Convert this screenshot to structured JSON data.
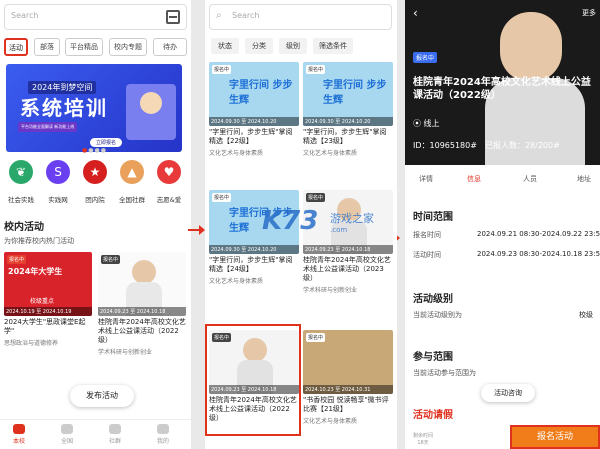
{
  "panel1": {
    "search_placeholder": "Search",
    "tabs": [
      "活动",
      "部落",
      "平台精品",
      "校内专题",
      "待办"
    ],
    "banner": {
      "line1": "2024年到梦空间",
      "line2": "系统培训",
      "line3": "平台功能全面解读 新功能上线",
      "button": "立即报名"
    },
    "icons": [
      {
        "label": "社会实践",
        "icon": "leaf-icon",
        "color": "#2aa76b"
      },
      {
        "label": "实践网",
        "icon": "s-logo-icon",
        "color": "#6a3ff0"
      },
      {
        "label": "团内院",
        "icon": "emblem-icon",
        "color": "#d62020"
      },
      {
        "label": "全国社群",
        "icon": "people-icon",
        "color": "#e8a05a"
      },
      {
        "label": "志愿&爱",
        "icon": "heart-icon",
        "color": "#e83a3a"
      }
    ],
    "section_title": "校内活动",
    "section_subtitle": "为你推荐校内热门活动",
    "cards": [
      {
        "img_text": "2024年大学生",
        "img_sub": "校级重点",
        "date": "2024.10.19 至 2024.10.19",
        "title": "2024大学生\"思政课堂E起学\"",
        "subtitle": "思想政治与道德修养"
      },
      {
        "img_text": "",
        "tag": "报名中",
        "date": "2024.09.23 至 2024.10.18",
        "title": "桂院青年2024年高校文化艺术线上公益课活动（2022级）",
        "subtitle": "学术科研与创新创业"
      }
    ],
    "fab": "发布活动",
    "nav": [
      "本校",
      "全国",
      "社群",
      "我的"
    ]
  },
  "panel2": {
    "search_placeholder": "Search",
    "filters": [
      "状态",
      "分类",
      "级别",
      "筛选条件"
    ],
    "cards": [
      {
        "tag": "报名中",
        "date": "2024.09.30 至 2024.10.20",
        "title": "\"字里行间，步步生辉\"掌阅精选【22级】",
        "subtitle": "文化艺术与身体素质"
      },
      {
        "tag": "报名中",
        "date": "2024.09.30 至 2024.10.20",
        "title": "\"字里行间，步步生辉\"掌阅精选【23级】",
        "subtitle": "文化艺术与身体素质"
      },
      {
        "tag": "报名中",
        "date": "2024.09.30 至 2024.10.20",
        "title": "\"字里行间，步步生辉\"掌阅精选【24级】",
        "subtitle": "文化艺术与身体素质"
      },
      {
        "tag": "报名中",
        "date": "2024.09.23 至 2024.10.18",
        "title": "桂院青年2024年高校文化艺术线上公益课活动（2023级）",
        "subtitle": "学术科研与创新创业"
      },
      {
        "tag": "报名中",
        "date": "2024.09.23 至 2024.10.18",
        "title": "桂院青年2024年高校文化艺术线上公益课活动（2022级）",
        "subtitle": ""
      },
      {
        "tag": "报名中",
        "date": "2024.10.23 至 2024.10.31",
        "title": "\"书香校园 悦读畅享\"微书评比赛【21级】",
        "subtitle": "文化艺术与身体素质"
      }
    ],
    "img_caption": "字里行间 步步生辉"
  },
  "panel3": {
    "more": "更多",
    "tag": "报名中",
    "title": "桂院青年2024年高校文化艺术线上公益课活动（2022级）",
    "online": "线上",
    "id": "ID：10965180#",
    "joined": "已报人数：28/200#",
    "tabs": [
      "详情",
      "信息",
      "人员",
      "地址"
    ],
    "time_heading": "时间范围",
    "rows": [
      {
        "label": "报名时间",
        "value": "2024.09.21 08:30-2024.09.22 23:59"
      },
      {
        "label": "活动时间",
        "value": "2024.09.23 08:30-2024.10.18 23:59"
      }
    ],
    "level_heading": "活动级别",
    "level_label": "当前活动级别为",
    "level_value": "校级",
    "scope_heading": "参与范围",
    "scope_label": "当前活动参与范围为",
    "ask": "活动咨询",
    "leave_heading": "活动请假",
    "remain_label": "剩余时间",
    "remain_value": "18天",
    "signup": "报名活动"
  },
  "watermark": {
    "main": "K73",
    "cn": "游戏之家",
    "url": ".com"
  }
}
